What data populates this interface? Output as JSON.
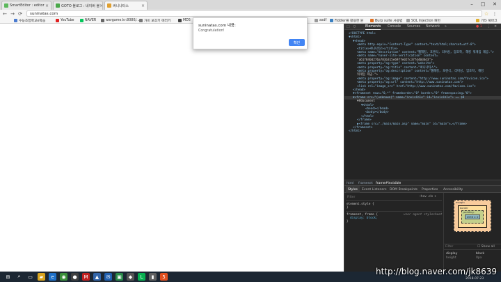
{
  "tabs": [
    {
      "title": "SmartEditor : editor",
      "color": "#5cb85c"
    },
    {
      "title": "GOTO 블로그 : 네이버 블",
      "color": "#4aa84a"
    },
    {
      "title": "써니나타스",
      "color": "#e0a030"
    }
  ],
  "window_controls": {
    "minimize": "–",
    "maximize": "□",
    "close": "✕"
  },
  "address_bar": {
    "url": "suninatas.com"
  },
  "toolbar_icons": {
    "back": "←",
    "forward": "→",
    "reload": "⟳",
    "menu": "⋮"
  },
  "bookmarks": [
    {
      "label": "수능조합학교e학습",
      "color": "#4a7bd0"
    },
    {
      "label": "YouTube",
      "color": "#e02020"
    },
    {
      "label": "NAVER",
      "color": "#03c75a"
    },
    {
      "label": "wargame.kr:8080/...",
      "color": "#666666"
    },
    {
      "label": "가비 보조키 에러키",
      "color": "#777777"
    },
    {
      "label": "MD5",
      "color": "#444444"
    },
    {
      "label": "asdf",
      "color": "#999999"
    },
    {
      "label": "Fiddler를 활용한 원",
      "color": "#3a80c0"
    },
    {
      "label": "Burp suite 사용법",
      "color": "#e07020"
    },
    {
      "label": "SQL Injection 패턴",
      "color": "#999999"
    },
    {
      "label": "기타 북마크",
      "color": "#e0b030"
    }
  ],
  "dialog": {
    "title": "suninatas.com 내용:",
    "message": "Congratulation!",
    "ok_label": "확인"
  },
  "devtools": {
    "tabs": [
      "Elements",
      "Console",
      "Sources",
      "Network",
      "»"
    ],
    "error_count": "1",
    "tree": [
      {
        "text": "<!DOCTYPE html>",
        "indent": 0
      },
      {
        "text": "▼<html>",
        "indent": 0
      },
      {
        "text": "▼<head>",
        "indent": 1
      },
      {
        "text": "<meta http-equiv=\"Content-Type\" content=\"text/html;charset=utf-8\">",
        "indent": 2
      },
      {
        "text": "<title>써니나타스</title>",
        "indent": 2
      },
      {
        "text": "<meta name=\"description\" content=\"웹해킹, 포렌식, 리버싱, 암호학, 해킹 워게임 제공.\">",
        "indent": 2
      },
      {
        "text": "<meta name=\"naver-site-verification\" content=",
        "indent": 2
      },
      {
        "text": "\"a61f840d276a783b315e697fe027c37fd40d4d3\">",
        "indent": 2
      },
      {
        "text": "<meta property=\"og:type\" content=\"website\">",
        "indent": 2
      },
      {
        "text": "<meta property=\"og:title\" content=\"써니나타스\">",
        "indent": 2
      },
      {
        "text": "<meta property=\"og:description\" content=\"웹해킹, 포렌식, 리버싱, 암호학, 해킹",
        "indent": 2
      },
      {
        "text": "워게임 제공.\">",
        "indent": 2
      },
      {
        "text": "<meta property=\"og:image\" content=\"http://www.suninatas.com/favicon.ico\">",
        "indent": 2
      },
      {
        "text": "<meta property=\"og:url\" content=\"http://www.suninatas.com\">",
        "indent": 2
      },
      {
        "text": "<link rel=\"image_src\" href=\"http://www.suninatas.com/favicon.ico\">",
        "indent": 2
      },
      {
        "text": "</head>",
        "indent": 1
      },
      {
        "text": "▼<frameset rows=\"0,*\" frameborder=\"0\" border=\"0\" framespacing=\"0\">",
        "indent": 1
      },
      {
        "text": "▼<frame src=\"(unknown)\" name=\"invisible\" id=\"invisible\"> == $0",
        "indent": 1,
        "selected": true
      },
      {
        "text": "▼#document",
        "indent": 2
      },
      {
        "text": "▼<html>",
        "indent": 3
      },
      {
        "text": "<head></head>",
        "indent": 4
      },
      {
        "text": "<body></body>",
        "indent": 4
      },
      {
        "text": "</html>",
        "indent": 3
      },
      {
        "text": "</frame>",
        "indent": 2
      },
      {
        "text": "▶<frame src=\"./main/main.asp\" name=\"main\" id=\"main\">…</frame>",
        "indent": 2
      },
      {
        "text": "</frameset>",
        "indent": 1
      },
      {
        "text": "</html>",
        "indent": 0
      }
    ],
    "breadcrumbs": [
      "html",
      "frameset",
      "frame#invisible"
    ],
    "style_tabs": [
      "Styles",
      "Event Listeners",
      "DOM Breakpoints",
      "Properties",
      "Accessibility"
    ],
    "filter_placeholder": "Filter",
    "hov_cls": ":hov .cls +",
    "rules": [
      {
        "selector": "element.style {",
        "decl": "",
        "close": "}",
        "source": ""
      },
      {
        "selector": "frameset, frame {",
        "decl": "display: block;",
        "close": "}",
        "source": "user agent stylesheet"
      }
    ],
    "box_model": {
      "margin_label": "margin",
      "border_label": "border",
      "padding_label": "padding -",
      "content": "1578 × 0",
      "dash": "–"
    },
    "computed_filter": "Filter",
    "show_all": "Show all",
    "computed": [
      {
        "prop": "display",
        "value": "block"
      },
      {
        "prop": "height",
        "value": "0px"
      }
    ]
  },
  "watermark": "http://blog.naver.com/jk8639",
  "clock": "2018-07-23",
  "taskbar_icons": [
    {
      "name": "windows-icon",
      "glyph": "⊞",
      "color": "#1c2733"
    },
    {
      "name": "search-icon",
      "glyph": "⌕",
      "color": "#1c2733"
    },
    {
      "name": "task-view-icon",
      "glyph": "▭",
      "color": "#1c2733"
    },
    {
      "name": "explorer-icon",
      "glyph": "▰",
      "color": "#d9a520"
    },
    {
      "name": "edge-icon",
      "glyph": "e",
      "color": "#1e70c8"
    },
    {
      "name": "chrome-icon",
      "glyph": "◉",
      "color": "#3a8f3a"
    },
    {
      "name": "app-icon-1",
      "glyph": "●",
      "color": "#404040"
    },
    {
      "name": "app-icon-2",
      "glyph": "M",
      "color": "#c02020"
    },
    {
      "name": "app-icon-3",
      "glyph": "▲",
      "color": "#3366aa"
    },
    {
      "name": "app-icon-4",
      "glyph": "✉",
      "color": "#2060b0"
    },
    {
      "name": "app-icon-5",
      "glyph": "▣",
      "color": "#2a8a4a"
    },
    {
      "name": "app-icon-6",
      "glyph": "◆",
      "color": "#555555"
    },
    {
      "name": "line-icon",
      "glyph": "L",
      "color": "#06b050"
    },
    {
      "name": "app-icon-7",
      "glyph": "▮",
      "color": "#606060"
    },
    {
      "name": "html-icon",
      "glyph": "5",
      "color": "#e05020"
    }
  ]
}
